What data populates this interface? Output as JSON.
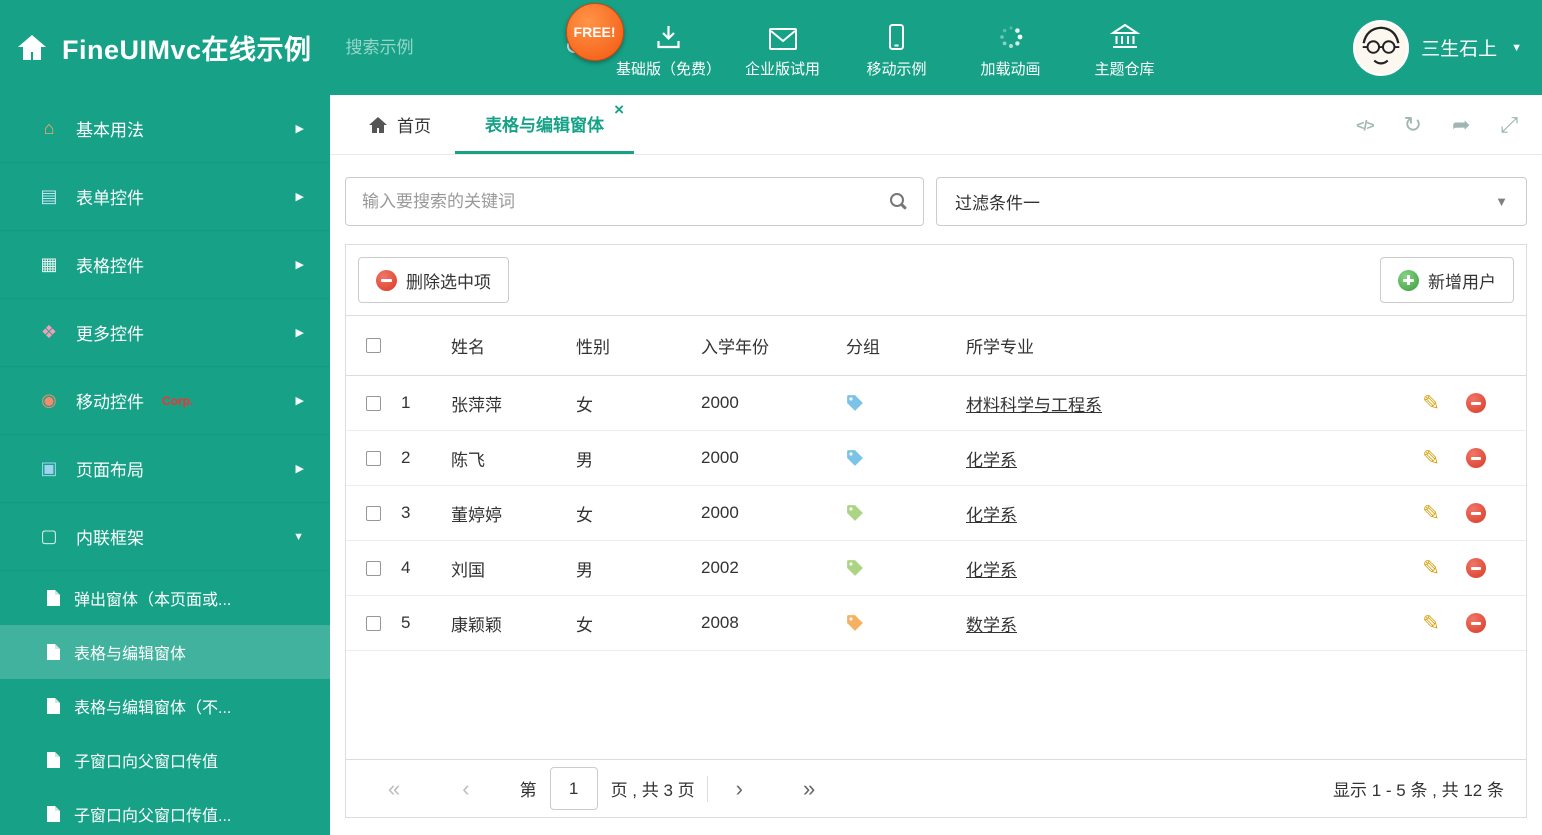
{
  "colors": {
    "theme": "#17A288",
    "delete_red": "#d93a25",
    "add_green": "#3f9c3f",
    "pencil_gold": "#d6a312",
    "free_orange": "#f3570f",
    "link": "#333333"
  },
  "icons": {
    "chevron_right": "▶",
    "chevron_down": "▼",
    "caret_down": "▼",
    "close": "×",
    "code": "</>",
    "refresh": "↻",
    "share": "➦",
    "expand": "⤢",
    "pencil": "✎",
    "first": "«",
    "prev": "‹",
    "next": "›",
    "last": "»"
  },
  "header": {
    "title": "FineUIMvc在线示例",
    "search_placeholder": "搜索示例",
    "free_badge": "FREE!",
    "nav_items": [
      {
        "label": "基础版（免费）",
        "icon": "download-icon"
      },
      {
        "label": "企业版试用",
        "icon": "envelope-icon"
      },
      {
        "label": "移动示例",
        "icon": "mobile-icon"
      },
      {
        "label": "加载动画",
        "icon": "spinner-icon"
      },
      {
        "label": "主题仓库",
        "icon": "bank-icon"
      }
    ],
    "user_name": "三生石上"
  },
  "sidebar": {
    "items": [
      {
        "label": "基本用法",
        "icon_glyph": "⌂",
        "icon_color": "#f6a96c"
      },
      {
        "label": "表单控件",
        "icon_glyph": "▤",
        "icon_color": "#bfe3f7"
      },
      {
        "label": "表格控件",
        "icon_glyph": "▦",
        "icon_color": "#e8f4ef"
      },
      {
        "label": "更多控件",
        "icon_glyph": "❖",
        "icon_color": "#f2a0b7"
      },
      {
        "label": "移动控件",
        "badge": "Corp.",
        "icon_glyph": "◉",
        "icon_color": "#f58c6e"
      },
      {
        "label": "页面布局",
        "icon_glyph": "▣",
        "icon_color": "#9fd4f0"
      },
      {
        "label": "内联框架",
        "icon_glyph": "▢",
        "icon_color": "#d9efe9"
      }
    ],
    "subitems": [
      {
        "label": "弹出窗体（本页面或..."
      },
      {
        "label": "表格与编辑窗体"
      },
      {
        "label": "表格与编辑窗体（不..."
      },
      {
        "label": "子窗口向父窗口传值"
      },
      {
        "label": "子窗口向父窗口传值..."
      }
    ]
  },
  "tabs": {
    "home": "首页",
    "active": "表格与编辑窗体"
  },
  "filters": {
    "search_placeholder": "输入要搜索的关键词",
    "selected_filter": "过滤条件一"
  },
  "toolbar": {
    "delete": "删除选中项",
    "add": "新增用户"
  },
  "table": {
    "headers": [
      "姓名",
      "性别",
      "入学年份",
      "分组",
      "所学专业"
    ],
    "rows": [
      {
        "num": "1",
        "name": "张萍萍",
        "gender": "女",
        "year": "2000",
        "tag_color": "#7cc3e8",
        "major": "材料科学与工程系"
      },
      {
        "num": "2",
        "name": "陈飞",
        "gender": "男",
        "year": "2000",
        "tag_color": "#7cc3e8",
        "major": "化学系"
      },
      {
        "num": "3",
        "name": "董婷婷",
        "gender": "女",
        "year": "2000",
        "tag_color": "#abd584",
        "major": "化学系"
      },
      {
        "num": "4",
        "name": "刘国",
        "gender": "男",
        "year": "2002",
        "tag_color": "#abd584",
        "major": "化学系"
      },
      {
        "num": "5",
        "name": "康颖颖",
        "gender": "女",
        "year": "2008",
        "tag_color": "#f5b062",
        "major": "数学系"
      }
    ]
  },
  "pagination": {
    "label_page": "第",
    "current": "1",
    "label_total": "页 , 共 3 页",
    "summary": "显示 1 - 5 条 , 共 12 条"
  }
}
